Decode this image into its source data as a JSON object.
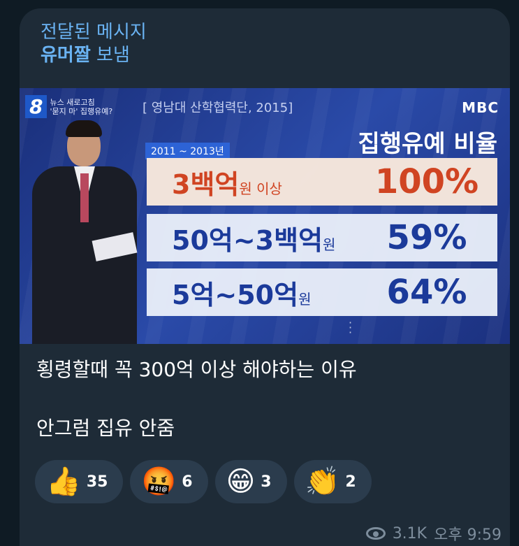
{
  "forward": {
    "header": "전달된 메시지",
    "from": "유머짤",
    "action": "보냄"
  },
  "media": {
    "news_number": "8",
    "news_line1": "뉴스 새로고침",
    "news_line2": "'묻지 마' 집행유예?",
    "source": "[ 영남대 산학협력단, 2015]",
    "broadcaster": "MBC",
    "period": "2011 ~ 2013년",
    "chart_title": "집행유예 비율",
    "rows": [
      {
        "amount": "3백억",
        "unit": "원 이상",
        "percent": "100%"
      },
      {
        "amount": "50억~3백억",
        "unit": "원",
        "percent": "59%"
      },
      {
        "amount": "5억~50억",
        "unit": "원",
        "percent": "64%"
      }
    ]
  },
  "caption": {
    "line1": "횡령할때 꼭 300억 이상 해야하는 이유",
    "line2": "안그럼 집유 안줌"
  },
  "reactions": [
    {
      "icon": "thumbs-up-icon",
      "emoji": "👍",
      "count": "35"
    },
    {
      "icon": "angry-cursing-face-icon",
      "emoji": "🤬",
      "count": "6"
    },
    {
      "icon": "grinning-face-icon",
      "emoji": "😁",
      "count": "3"
    },
    {
      "icon": "clapping-hands-icon",
      "emoji": "👏",
      "count": "2"
    }
  ],
  "meta": {
    "views": "3.1K",
    "time": "오후 9:59"
  },
  "colors": {
    "accent": "#6ab3f3",
    "bubble": "#1e2b37",
    "reaction_bg": "#2b3c4d"
  }
}
